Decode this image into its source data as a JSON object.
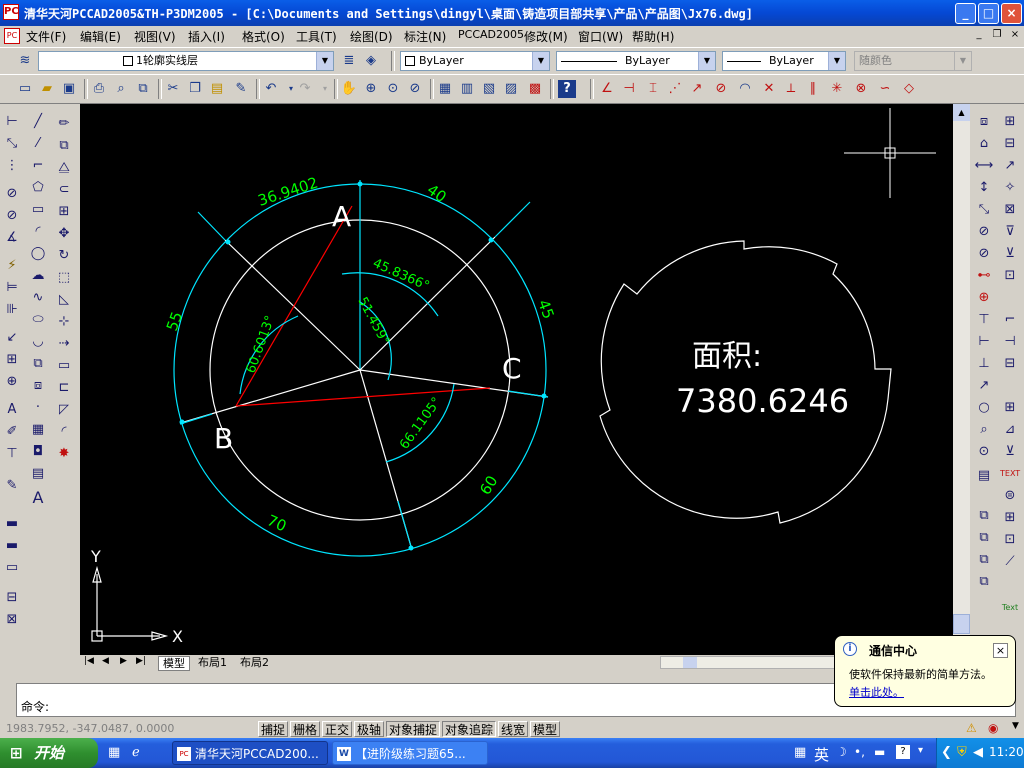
{
  "window": {
    "title": "清华天河PCCAD2005&TH-P3DM2005 - [C:\\Documents and Settings\\dingyl\\桌面\\铸造项目部共享\\产品\\产品图\\Jx76.dwg]",
    "app_icon": "PC",
    "minimize": "_",
    "maximize": "□",
    "close": "×"
  },
  "menu": {
    "items": [
      "文件(F)",
      "编辑(E)",
      "视图(V)",
      "插入(I)",
      "格式(O)",
      "工具(T)",
      "绘图(D)",
      "标注(N)",
      "PCCAD2005",
      "修改(M)",
      "窗口(W)",
      "帮助(H)"
    ],
    "mdi_min": "_",
    "mdi_restore": "❐",
    "mdi_close": "×"
  },
  "layer_toolbar": {
    "layer_name": "1轮廓实线层",
    "color": "ByLayer",
    "linetype": "ByLayer",
    "lineweight": "ByLayer",
    "plotstyle": "随颜色"
  },
  "drawing": {
    "label_a": "A",
    "label_b": "B",
    "label_c": "C",
    "dim_36": "36.9402",
    "dim_40": "40",
    "dim_45": "45.8366°",
    "dim_51": "51.459°",
    "dim_60d": "60.6013°",
    "dim_55": "55",
    "dim_45b": "45",
    "dim_66": "66.1105°",
    "dim_60": "60",
    "dim_70": "70",
    "area_label": "面积:",
    "area_value": "7380.6246",
    "ucs_x": "X",
    "ucs_y": "Y"
  },
  "layout_tabs": [
    "模型",
    "布局1",
    "布局2"
  ],
  "command": {
    "prompt": "命令:"
  },
  "status": {
    "coords": "1983.7952, -347.0487, 0.0000",
    "buttons": [
      "捕捉",
      "栅格",
      "正交",
      "极轴",
      "对象捕捉",
      "对象追踪",
      "线宽",
      "模型"
    ]
  },
  "balloon": {
    "title": "通信中心",
    "message": "使软件保持最新的简单方法。",
    "link": "单击此处。",
    "close": "×"
  },
  "taskbar": {
    "start": "开始",
    "tasks": [
      "清华天河PCCAD200...",
      "【进阶级练习题65..."
    ],
    "tray_lang": "英",
    "clock": "11:20"
  },
  "colors": {
    "canvas": "#000000",
    "cyan": "#00e5ff",
    "green": "#00ff00",
    "red": "#ff0000",
    "white": "#ffffff"
  }
}
